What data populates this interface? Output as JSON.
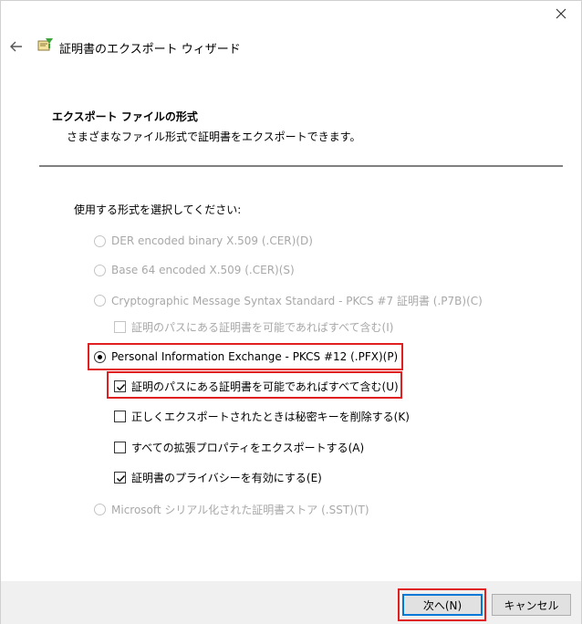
{
  "window": {
    "close_icon": "close-icon"
  },
  "header": {
    "back_icon": "back-arrow-icon",
    "wizard_icon": "certificate-icon",
    "title": "証明書のエクスポート ウィザード"
  },
  "section": {
    "title": "エクスポート ファイルの形式",
    "description": "さまざまなファイル形式で証明書をエクスポートできます。"
  },
  "form": {
    "prompt": "使用する形式を選択してください:",
    "options": [
      {
        "label": "DER encoded binary X.509 (.CER)(D)",
        "type": "radio",
        "checked": false,
        "enabled": false
      },
      {
        "label": "Base 64 encoded X.509 (.CER)(S)",
        "type": "radio",
        "checked": false,
        "enabled": false
      },
      {
        "label": "Cryptographic Message Syntax Standard - PKCS #7 証明書 (.P7B)(C)",
        "type": "radio",
        "checked": false,
        "enabled": false
      },
      {
        "label": "証明のパスにある証明書を可能であればすべて含む(I)",
        "type": "checkbox",
        "checked": false,
        "enabled": false
      },
      {
        "label": "Personal Information Exchange - PKCS #12 (.PFX)(P)",
        "type": "radio",
        "checked": true,
        "enabled": true
      },
      {
        "label": "証明のパスにある証明書を可能であればすべて含む(U)",
        "type": "checkbox",
        "checked": true,
        "enabled": true
      },
      {
        "label": "正しくエクスポートされたときは秘密キーを削除する(K)",
        "type": "checkbox",
        "checked": false,
        "enabled": true
      },
      {
        "label": "すべての拡張プロパティをエクスポートする(A)",
        "type": "checkbox",
        "checked": false,
        "enabled": true
      },
      {
        "label": "証明書のプライバシーを有効にする(E)",
        "type": "checkbox",
        "checked": true,
        "enabled": true
      },
      {
        "label": "Microsoft シリアル化された証明書ストア (.SST)(T)",
        "type": "radio",
        "checked": false,
        "enabled": false
      }
    ]
  },
  "footer": {
    "next_label": "次へ(N)",
    "cancel_label": "キャンセル"
  },
  "colors": {
    "highlight": "#e02020",
    "disabled_text": "#a8a8a8",
    "footer_bg": "#f0f0f0",
    "separator": "#808080"
  }
}
